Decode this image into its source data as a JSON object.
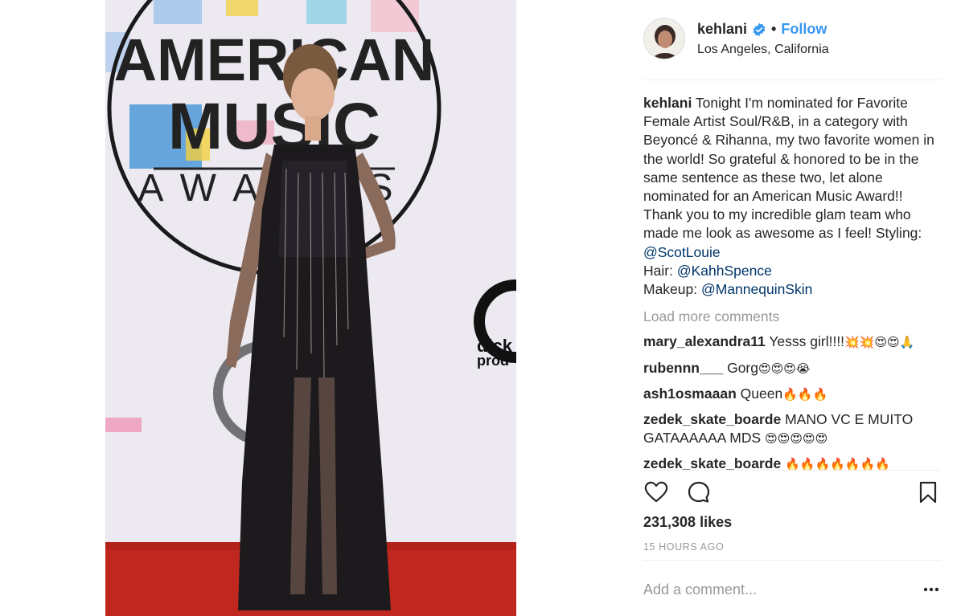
{
  "post": {
    "photo_alt": "Kehlani at the American Music Awards red carpet",
    "backdrop": {
      "line1": "AMERICAN",
      "line2": "MUSIC",
      "line3": "AWARDS",
      "sponsor1": "dick",
      "sponsor2": "prod"
    }
  },
  "header": {
    "username": "kehlani",
    "dot": "•",
    "follow_label": "Follow",
    "location": "Los Angeles, California"
  },
  "caption": {
    "username": "kehlani",
    "text": "Tonight I'm nominated for Favorite Female Artist Soul/R&B, in a category with Beyoncé & Rihanna, my two favorite women in the world! So grateful & honored to be in the same sentence as these two, let alone nominated for an American Music Award!! Thank you to my incredible glam team who made me look as awesome as I feel! Styling: ",
    "styling_tag": "@ScotLouie",
    "hair_label": "Hair: ",
    "hair_tag": "@KahhSpence",
    "makeup_label": "Makeup: ",
    "makeup_tag": "@MannequinSkin"
  },
  "load_more": "Load more comments",
  "comments": [
    {
      "user": "mary_alexandra11",
      "text": "Yesss girl!!!!",
      "emoji": "💥💥😍😍🙏"
    },
    {
      "user": "rubennn___",
      "text": "Gorg",
      "emoji": "😍😍😍😭"
    },
    {
      "user": "ash1osmaaan",
      "text": "Queen",
      "emoji": "🔥🔥🔥"
    },
    {
      "user": "zedek_skate_boarde",
      "text": "MANO VC E MUITO GATAAAAAA MDS",
      "emoji": "😍😍😍😍😍"
    },
    {
      "user": "zedek_skate_boarde",
      "text": "",
      "emoji": "🔥🔥🔥🔥🔥🔥🔥"
    }
  ],
  "likes": "231,308 likes",
  "time_ago": "15 HOURS AGO",
  "add_comment_placeholder": "Add a comment...",
  "icons": {
    "like": "heart-icon",
    "comment": "comment-icon",
    "save": "bookmark-icon",
    "more": "more-options-icon",
    "verified": "verified-badge-icon"
  },
  "colors": {
    "link_blue": "#3897f0",
    "mention_blue": "#003569",
    "muted": "#999999",
    "text": "#262626",
    "carpet": "#c0271f"
  }
}
